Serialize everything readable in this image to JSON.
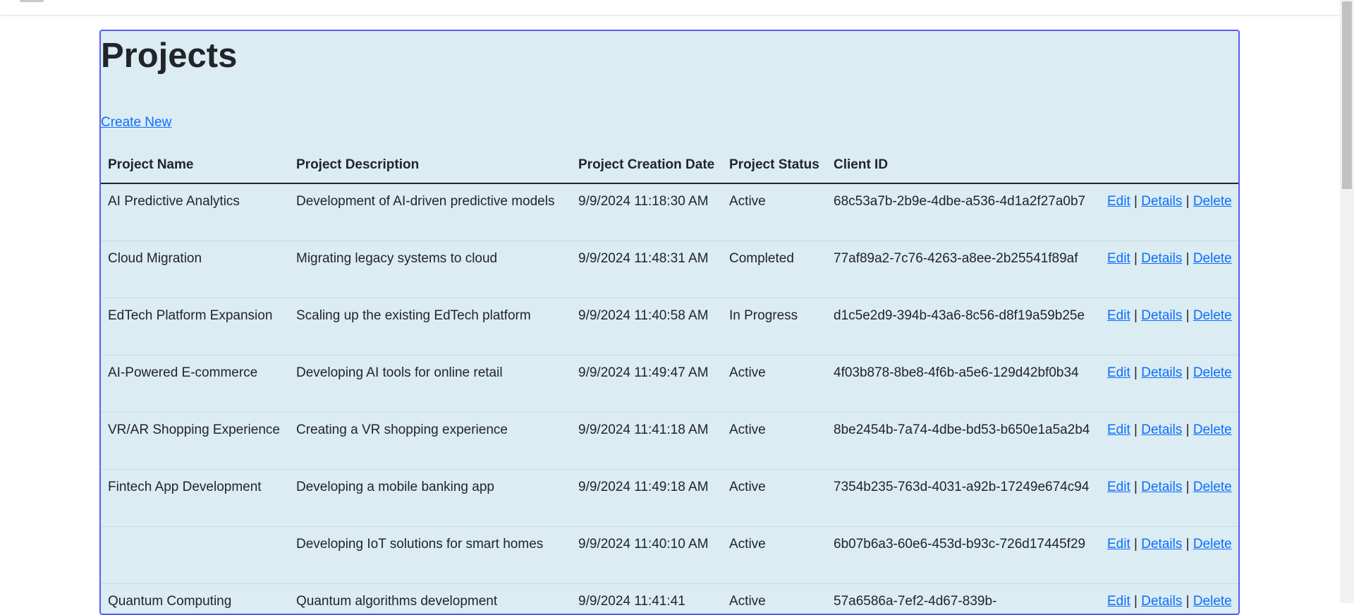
{
  "page": {
    "title": "Projects",
    "create_label": "Create New"
  },
  "table": {
    "headers": {
      "name": "Project Name",
      "description": "Project Description",
      "date": "Project Creation Date",
      "status": "Project Status",
      "client": "Client ID"
    },
    "actions": {
      "edit": "Edit",
      "details": "Details",
      "delete": "Delete",
      "separator": "|"
    },
    "rows": [
      {
        "name": "AI Predictive Analytics",
        "description": "Development of AI-driven predictive models",
        "date": "9/9/2024 11:18:30 AM",
        "status": "Active",
        "client": "68c53a7b-2b9e-4dbe-a536-4d1a2f27a0b7"
      },
      {
        "name": "Cloud Migration",
        "description": "Migrating legacy systems to cloud",
        "date": "9/9/2024 11:48:31 AM",
        "status": "Completed",
        "client": "77af89a2-7c76-4263-a8ee-2b25541f89af"
      },
      {
        "name": "EdTech Platform Expansion",
        "description": "Scaling up the existing EdTech platform",
        "date": "9/9/2024 11:40:58 AM",
        "status": "In Progress",
        "client": "d1c5e2d9-394b-43a6-8c56-d8f19a59b25e"
      },
      {
        "name": "AI-Powered E-commerce",
        "description": "Developing AI tools for online retail",
        "date": "9/9/2024 11:49:47 AM",
        "status": "Active",
        "client": "4f03b878-8be8-4f6b-a5e6-129d42bf0b34"
      },
      {
        "name": "VR/AR Shopping Experience",
        "description": "Creating a VR shopping experience",
        "date": "9/9/2024 11:41:18 AM",
        "status": "Active",
        "client": "8be2454b-7a74-4dbe-bd53-b650e1a5a2b4"
      },
      {
        "name": "Fintech App Development",
        "description": "Developing a mobile banking app",
        "date": "9/9/2024 11:49:18 AM",
        "status": "Active",
        "client": "7354b235-763d-4031-a92b-17249e674c94"
      },
      {
        "name": "",
        "description": "Developing IoT solutions for smart homes",
        "date": "9/9/2024 11:40:10 AM",
        "status": "Active",
        "client": "6b07b6a3-60e6-453d-b93c-726d17445f29"
      },
      {
        "name": "Quantum Computing",
        "description": "Quantum algorithms development",
        "date": "9/9/2024 11:41:41",
        "status": "Active",
        "client": "57a6586a-7ef2-4d67-839b-"
      }
    ]
  }
}
